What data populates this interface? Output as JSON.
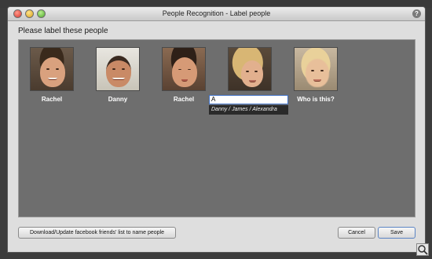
{
  "window": {
    "title": "People Recognition - Label people"
  },
  "prompt": "Please label these people",
  "people": [
    {
      "name": "Rachel"
    },
    {
      "name": "Danny"
    },
    {
      "name": "Rachel"
    },
    {
      "name": ""
    },
    {
      "name": "Who is this?"
    }
  ],
  "name_input": {
    "value": "A"
  },
  "suggestions": "Danny / James / Alexandra",
  "buttons": {
    "facebook": "Download/Update facebook friends' list to name people",
    "cancel": "Cancel",
    "save": "Save"
  },
  "icons": {
    "help": "help-icon",
    "magnifier": "magnifier-icon"
  }
}
